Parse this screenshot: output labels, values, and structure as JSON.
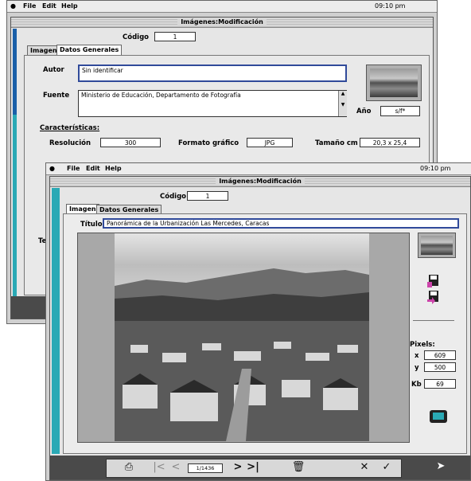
{
  "pointer_arrow": "down-arrow",
  "back_window": {
    "menubar": {
      "file": "File",
      "edit": "Edit",
      "help": "Help",
      "time": "09:10 pm"
    },
    "title": "Imágenes:Modificación",
    "codigo_label": "Código",
    "codigo_value": "1",
    "tabs": [
      {
        "label": "Imagen"
      },
      {
        "label": "Datos Generales"
      }
    ],
    "autor_label": "Autor",
    "autor_value": "Sin identificar",
    "fuente_label": "Fuente",
    "fuente_value": "Ministerio de Educación, Departamento de Fotografía",
    "ano_label": "Año",
    "ano_value": "s/f*",
    "caracteristicas_label": "Características:",
    "resolucion_label": "Resolución",
    "resolucion_value": "300",
    "formato_label": "Formato gráfico",
    "formato_value": "JPG",
    "tamano_label": "Tamaño cm",
    "tamano_value": "20,3 x 25,4",
    "partial_label": "Ter"
  },
  "front_window": {
    "menubar": {
      "file": "File",
      "edit": "Edit",
      "help": "Help",
      "time": "09:10 pm"
    },
    "title": "Imágenes:Modificación",
    "codigo_label": "Código",
    "codigo_value": "1",
    "tabs": [
      {
        "label": "Imagen"
      },
      {
        "label": "Datos Generales"
      }
    ],
    "titulo_label": "Título",
    "titulo_value": "Panorámica de la Urbanización Las Mercedes, Caracas",
    "pixels_label": "Pixels:",
    "x_label": "x",
    "x_value": "609",
    "y_label": "y",
    "y_value": "500",
    "kb_label": "Kb",
    "kb_value": "69",
    "record_counter": "1/1436",
    "icons": [
      "print-icon",
      "first-record-icon",
      "previous-record-icon",
      "next-record-icon",
      "last-record-icon",
      "delete-icon",
      "cancel-icon",
      "accept-icon",
      "save-icon",
      "export-icon",
      "monitor-icon",
      "cursor-icon"
    ]
  },
  "colors": {
    "accent_teal": "#2aa9b5",
    "accent_blue": "#1a5fa8",
    "toolbar": "#4a4a4a"
  }
}
